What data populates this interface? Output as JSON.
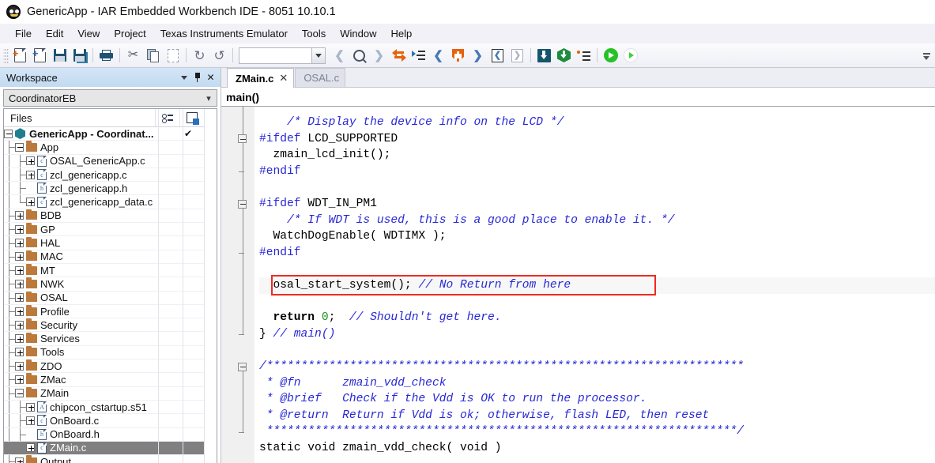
{
  "window": {
    "title": "GenericApp - IAR Embedded Workbench IDE - 8051 10.10.1",
    "icon": "app-logo-icon"
  },
  "menu": {
    "items": [
      {
        "label": "File"
      },
      {
        "label": "Edit"
      },
      {
        "label": "View"
      },
      {
        "label": "Project"
      },
      {
        "label": "Texas Instruments Emulator"
      },
      {
        "label": "Tools"
      },
      {
        "label": "Window"
      },
      {
        "label": "Help"
      }
    ]
  },
  "toolbar": {
    "combo_value": "",
    "buttons": [
      {
        "name": "new-document-icon",
        "title": "New Document"
      },
      {
        "name": "new-workspace-icon",
        "title": "New Workspace"
      },
      {
        "name": "save-icon",
        "title": "Save"
      },
      {
        "name": "save-all-icon",
        "title": "Save All"
      },
      {
        "name": "print-icon",
        "title": "Print"
      },
      {
        "name": "cut-icon",
        "title": "Cut"
      },
      {
        "name": "copy-icon",
        "title": "Copy"
      },
      {
        "name": "paste-icon",
        "title": "Paste"
      },
      {
        "name": "undo-icon",
        "title": "Undo"
      },
      {
        "name": "redo-icon",
        "title": "Redo"
      },
      {
        "name": "navigate-backward-icon",
        "title": "Navigate Backward"
      },
      {
        "name": "find-icon",
        "title": "Quick Search"
      },
      {
        "name": "navigate-forward-icon",
        "title": "Navigate Forward"
      },
      {
        "name": "replace-icon",
        "title": "Go To"
      },
      {
        "name": "bookmark-list-icon",
        "title": "Bookmarks"
      },
      {
        "name": "previous-bookmark-icon",
        "title": "Previous Bookmark"
      },
      {
        "name": "toggle-bookmark-icon",
        "title": "Toggle Bookmark"
      },
      {
        "name": "next-bookmark-icon",
        "title": "Next Bookmark"
      },
      {
        "name": "previous-file-icon",
        "title": "Previous File"
      },
      {
        "name": "next-file-icon",
        "title": "Next File"
      },
      {
        "name": "download-icon",
        "title": "Download"
      },
      {
        "name": "download-and-debug-icon",
        "title": "Download and Debug"
      },
      {
        "name": "compile-list-icon",
        "title": "Compile"
      },
      {
        "name": "run-icon",
        "title": "Download and Debug"
      },
      {
        "name": "debug-without-download-icon",
        "title": "Debug without Downloading"
      }
    ],
    "overflow_label": "More buttons"
  },
  "workspace": {
    "panel_title": "Workspace",
    "controls": {
      "menu": "dropdown-menu-icon",
      "pin": "pin-icon",
      "close": "close-icon"
    },
    "configuration": "CoordinatorEB",
    "column_header": "Files",
    "header_icons": [
      {
        "name": "show-dependencies-icon"
      },
      {
        "name": "make-icon"
      }
    ],
    "tree": [
      {
        "label": "GenericApp - Coordinat...",
        "type": "project",
        "depth": 0,
        "expander": "minus",
        "check": "✔"
      },
      {
        "label": "App",
        "type": "folder",
        "depth": 1,
        "expander": "minus",
        "guide": "tee"
      },
      {
        "label": "OSAL_GenericApp.c",
        "type": "file-c",
        "depth": 2,
        "expander": "plus",
        "guide": "tee"
      },
      {
        "label": "zcl_genericapp.c",
        "type": "file-c",
        "depth": 2,
        "expander": "plus",
        "guide": "tee"
      },
      {
        "label": "zcl_genericapp.h",
        "type": "file-h",
        "depth": 2,
        "expander": "none",
        "guide": "tee"
      },
      {
        "label": "zcl_genericapp_data.c",
        "type": "file-c",
        "depth": 2,
        "expander": "plus",
        "guide": "ell"
      },
      {
        "label": "BDB",
        "type": "folder",
        "depth": 1,
        "expander": "plus",
        "guide": "tee"
      },
      {
        "label": "GP",
        "type": "folder",
        "depth": 1,
        "expander": "plus",
        "guide": "tee"
      },
      {
        "label": "HAL",
        "type": "folder",
        "depth": 1,
        "expander": "plus",
        "guide": "tee"
      },
      {
        "label": "MAC",
        "type": "folder",
        "depth": 1,
        "expander": "plus",
        "guide": "tee"
      },
      {
        "label": "MT",
        "type": "folder",
        "depth": 1,
        "expander": "plus",
        "guide": "tee"
      },
      {
        "label": "NWK",
        "type": "folder",
        "depth": 1,
        "expander": "plus",
        "guide": "tee"
      },
      {
        "label": "OSAL",
        "type": "folder",
        "depth": 1,
        "expander": "plus",
        "guide": "tee"
      },
      {
        "label": "Profile",
        "type": "folder",
        "depth": 1,
        "expander": "plus",
        "guide": "tee"
      },
      {
        "label": "Security",
        "type": "folder",
        "depth": 1,
        "expander": "plus",
        "guide": "tee"
      },
      {
        "label": "Services",
        "type": "folder",
        "depth": 1,
        "expander": "plus",
        "guide": "tee"
      },
      {
        "label": "Tools",
        "type": "folder",
        "depth": 1,
        "expander": "plus",
        "guide": "tee"
      },
      {
        "label": "ZDO",
        "type": "folder",
        "depth": 1,
        "expander": "plus",
        "guide": "tee"
      },
      {
        "label": "ZMac",
        "type": "folder",
        "depth": 1,
        "expander": "plus",
        "guide": "tee"
      },
      {
        "label": "ZMain",
        "type": "folder",
        "depth": 1,
        "expander": "minus",
        "guide": "tee"
      },
      {
        "label": "chipcon_cstartup.s51",
        "type": "file-a",
        "depth": 2,
        "expander": "plus",
        "guide": "tee"
      },
      {
        "label": "OnBoard.c",
        "type": "file-c",
        "depth": 2,
        "expander": "plus",
        "guide": "tee"
      },
      {
        "label": "OnBoard.h",
        "type": "file-h",
        "depth": 2,
        "expander": "none",
        "guide": "tee"
      },
      {
        "label": "ZMain.c",
        "type": "file-c",
        "depth": 2,
        "expander": "plus",
        "guide": "ell",
        "selected": true
      },
      {
        "label": "Output",
        "type": "folder",
        "depth": 1,
        "expander": "plus",
        "guide": "tee"
      }
    ]
  },
  "editor": {
    "tabs": [
      {
        "label": "ZMain.c",
        "active": true,
        "close": "✕"
      },
      {
        "label": "OSAL.c",
        "active": false
      }
    ],
    "breadcrumb": "main()",
    "annotation": {
      "color": "#ef2a20",
      "target": "osal_start_system(); // No Return from here"
    },
    "lines": [
      {
        "id": "l1",
        "indent": "    ",
        "segs": [
          {
            "t": "/* Display the device info on the LCD */",
            "c": "cmt"
          }
        ]
      },
      {
        "id": "l2",
        "indent": "",
        "segs": [
          {
            "t": "#ifdef ",
            "c": "pp"
          },
          {
            "t": "LCD_SUPPORTED",
            "c": ""
          }
        ]
      },
      {
        "id": "l3",
        "indent": "  ",
        "segs": [
          {
            "t": "zmain_lcd_init();",
            "c": ""
          }
        ]
      },
      {
        "id": "l4",
        "indent": "",
        "segs": [
          {
            "t": "#endif",
            "c": "pp"
          }
        ]
      },
      {
        "id": "l5",
        "indent": "",
        "segs": []
      },
      {
        "id": "l6",
        "indent": "",
        "segs": [
          {
            "t": "#ifdef ",
            "c": "pp"
          },
          {
            "t": "WDT_IN_PM1",
            "c": ""
          }
        ]
      },
      {
        "id": "l7",
        "indent": "    ",
        "segs": [
          {
            "t": "/* If WDT is used, this is a good place to enable it. */",
            "c": "cmt"
          }
        ]
      },
      {
        "id": "l8",
        "indent": "  ",
        "segs": [
          {
            "t": "WatchDogEnable( WDTIMX );",
            "c": ""
          }
        ]
      },
      {
        "id": "l9",
        "indent": "",
        "segs": [
          {
            "t": "#endif",
            "c": "pp"
          }
        ]
      },
      {
        "id": "l10",
        "indent": "",
        "segs": []
      },
      {
        "id": "l11",
        "indent": "  ",
        "segs": [
          {
            "t": "osal_start_system(); ",
            "c": ""
          },
          {
            "t": "// No Return from here",
            "c": "cmt"
          }
        ],
        "highlight": true
      },
      {
        "id": "l12",
        "indent": "",
        "segs": []
      },
      {
        "id": "l13",
        "indent": "  ",
        "segs": [
          {
            "t": "return",
            "c": "kw"
          },
          {
            "t": " ",
            "c": ""
          },
          {
            "t": "0",
            "c": "num"
          },
          {
            "t": ";  ",
            "c": ""
          },
          {
            "t": "// Shouldn't get here.",
            "c": "cmt"
          }
        ]
      },
      {
        "id": "l14",
        "indent": "",
        "segs": [
          {
            "t": "} ",
            "c": ""
          },
          {
            "t": "// main()",
            "c": "cmt"
          }
        ]
      },
      {
        "id": "l15",
        "indent": "",
        "segs": []
      },
      {
        "id": "l16",
        "indent": "",
        "segs": [
          {
            "t": "/*********************************************************************",
            "c": "cmt"
          }
        ]
      },
      {
        "id": "l17",
        "indent": "",
        "segs": [
          {
            "t": " * @fn      zmain_vdd_check",
            "c": "cmt"
          }
        ]
      },
      {
        "id": "l18",
        "indent": "",
        "segs": [
          {
            "t": " * @brief   Check if the Vdd is OK to run the processor.",
            "c": "cmt"
          }
        ]
      },
      {
        "id": "l19",
        "indent": "",
        "segs": [
          {
            "t": " * @return  Return if Vdd is ok; otherwise, flash LED, then reset",
            "c": "cmt"
          }
        ]
      },
      {
        "id": "l20",
        "indent": "",
        "segs": [
          {
            "t": " ********************************************************************/",
            "c": "cmt"
          }
        ]
      },
      {
        "id": "l21",
        "indent": "",
        "segs": [
          {
            "t": "static void zmain_vdd_check( void )",
            "c": ""
          }
        ]
      }
    ]
  }
}
